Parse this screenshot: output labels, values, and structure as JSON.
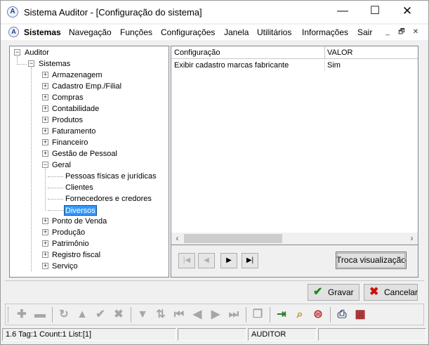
{
  "window": {
    "title": "Sistema Auditor - [Configuração do sistema]",
    "app_icon_letter": "A",
    "controls": {
      "minimize": "—",
      "maximize": "☐",
      "close": "✕"
    }
  },
  "menu": {
    "items": [
      "Sistemas",
      "Navegação",
      "Funções",
      "Configurações",
      "Janela",
      "Utilitários",
      "Informações",
      "Sair"
    ],
    "mdi_controls": [
      "_",
      "🗗",
      "✕"
    ]
  },
  "tree": {
    "root": "Auditor",
    "sistemas": "Sistemas",
    "modules": [
      "Armazenagem",
      "Cadastro Emp./Filial",
      "Compras",
      "Contabilidade",
      "Produtos",
      "Faturamento",
      "Financeiro",
      "Gestão de Pessoal",
      "Geral"
    ],
    "geral_children": [
      "Pessoas físicas e jurídicas",
      "Clientes",
      "Fornecedores e credores",
      "Diversos"
    ],
    "modules_after": [
      "Ponto de Venda",
      "Produção",
      "Patrimônio",
      "Registro fiscal",
      "Serviço"
    ],
    "selected": "Diversos"
  },
  "grid": {
    "columns": [
      "Configuração",
      "VALOR"
    ],
    "rows": [
      {
        "config": "Exibir cadastro marcas fabricante",
        "valor": "Sim"
      }
    ]
  },
  "navigator": {
    "first": "|◀",
    "prior": "◀",
    "next": "▶",
    "last": "▶|",
    "toggle_view_label": "Troca visualização"
  },
  "actions": {
    "save_label": "Gravar",
    "cancel_label": "Cancelar",
    "save_color": "#1a8a1a",
    "cancel_color": "#cc1010"
  },
  "status": {
    "info": "1.6 Tag:1 Count:1 List:[1]",
    "user": "AUDITOR",
    "panel_2": "",
    "panel_4": ""
  }
}
